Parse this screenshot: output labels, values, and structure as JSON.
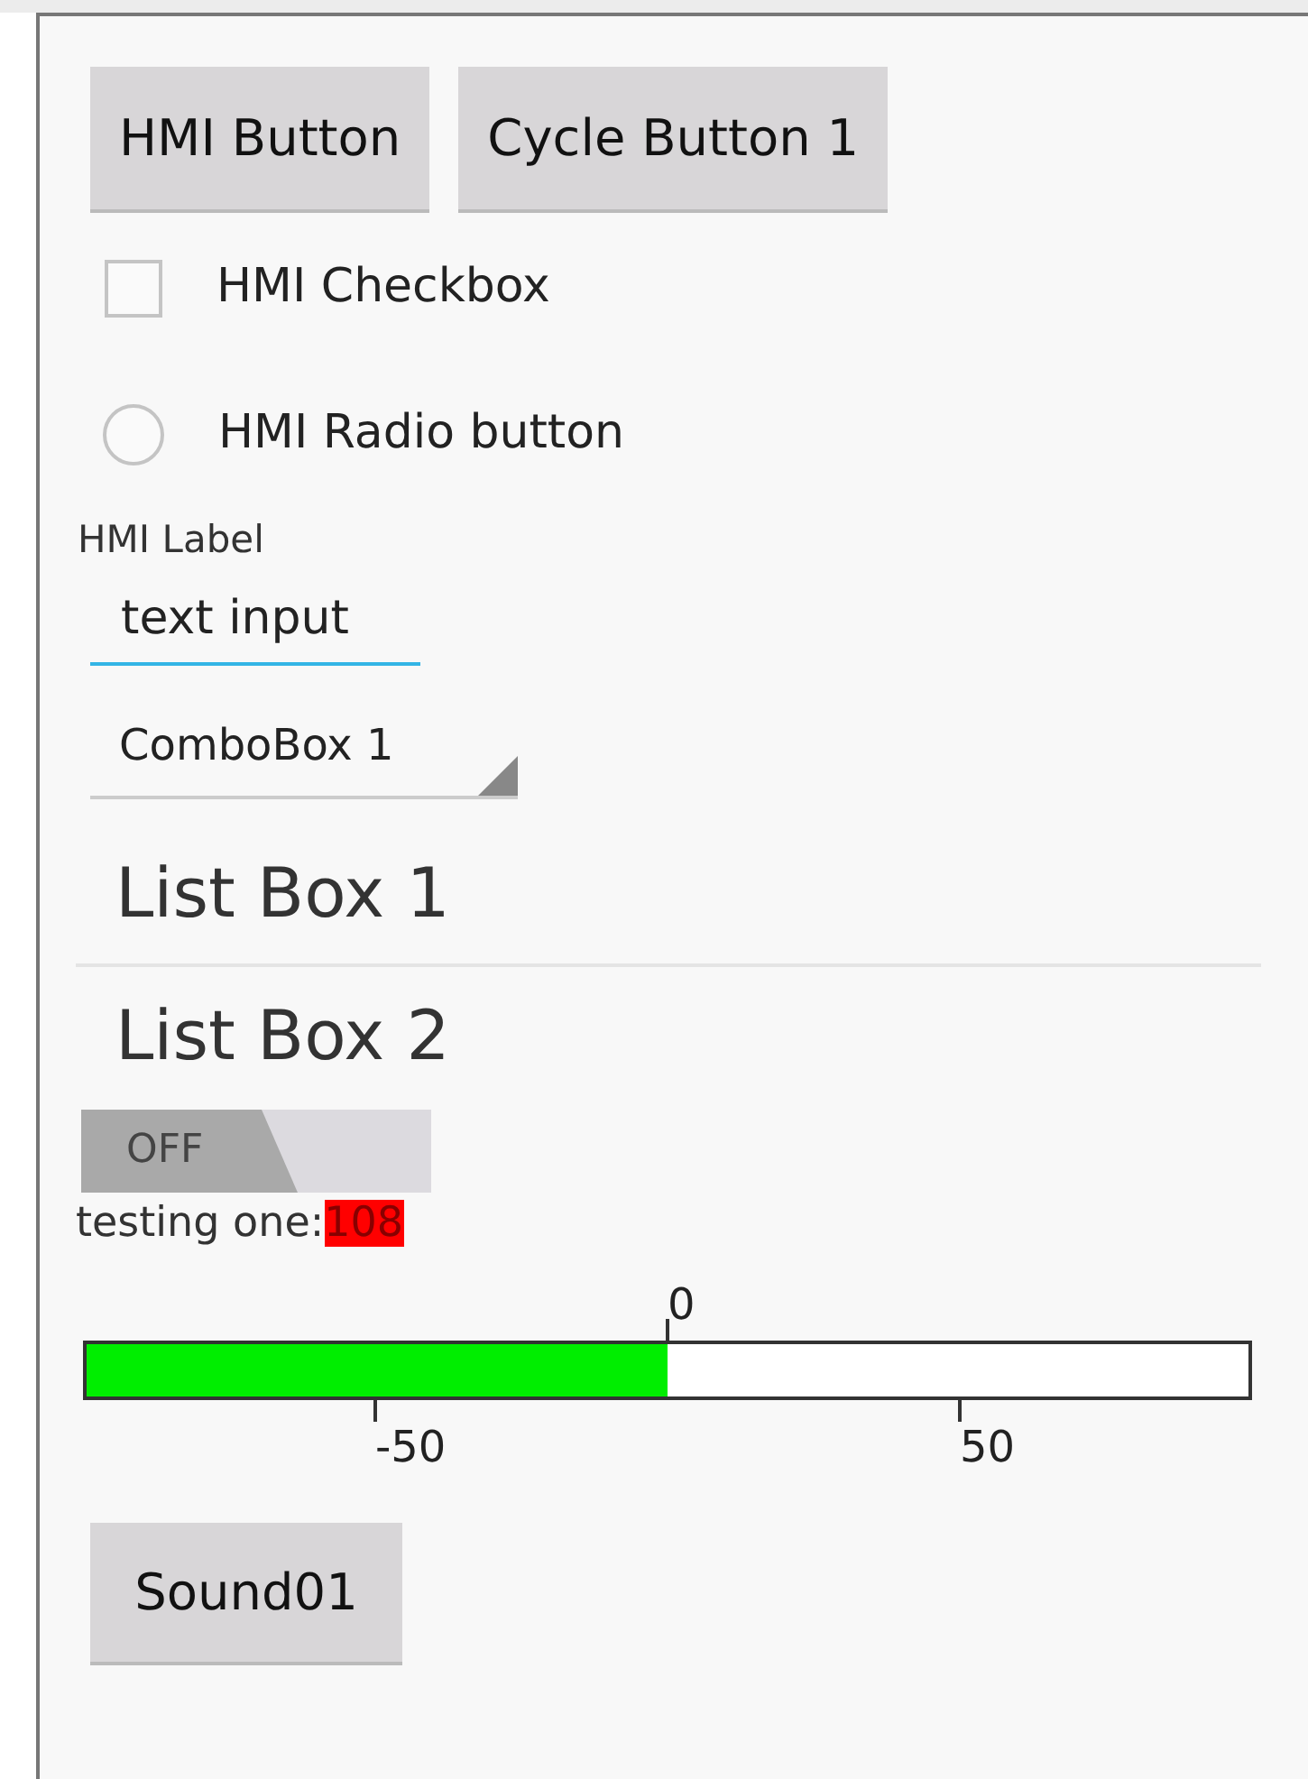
{
  "buttons": [
    {
      "label": "HMI Button"
    },
    {
      "label": "Cycle Button 1"
    }
  ],
  "checkbox": {
    "label": "HMI Checkbox",
    "checked": false
  },
  "radio": {
    "label": "HMI Radio button",
    "selected": false
  },
  "label": "HMI Label",
  "text_input": {
    "value": "text input"
  },
  "combobox": {
    "value": "ComboBox 1"
  },
  "list_items": [
    "List Box 1",
    "List Box 2"
  ],
  "toggle": {
    "label": "OFF",
    "on": false
  },
  "readout": {
    "label": "testing one:",
    "value": "108",
    "alarm": true
  },
  "gauge": {
    "level": 0.5,
    "ticks_above": [
      "0"
    ],
    "ticks_below": [
      "-50",
      "50"
    ]
  },
  "sound_button": {
    "label": "Sound01"
  }
}
